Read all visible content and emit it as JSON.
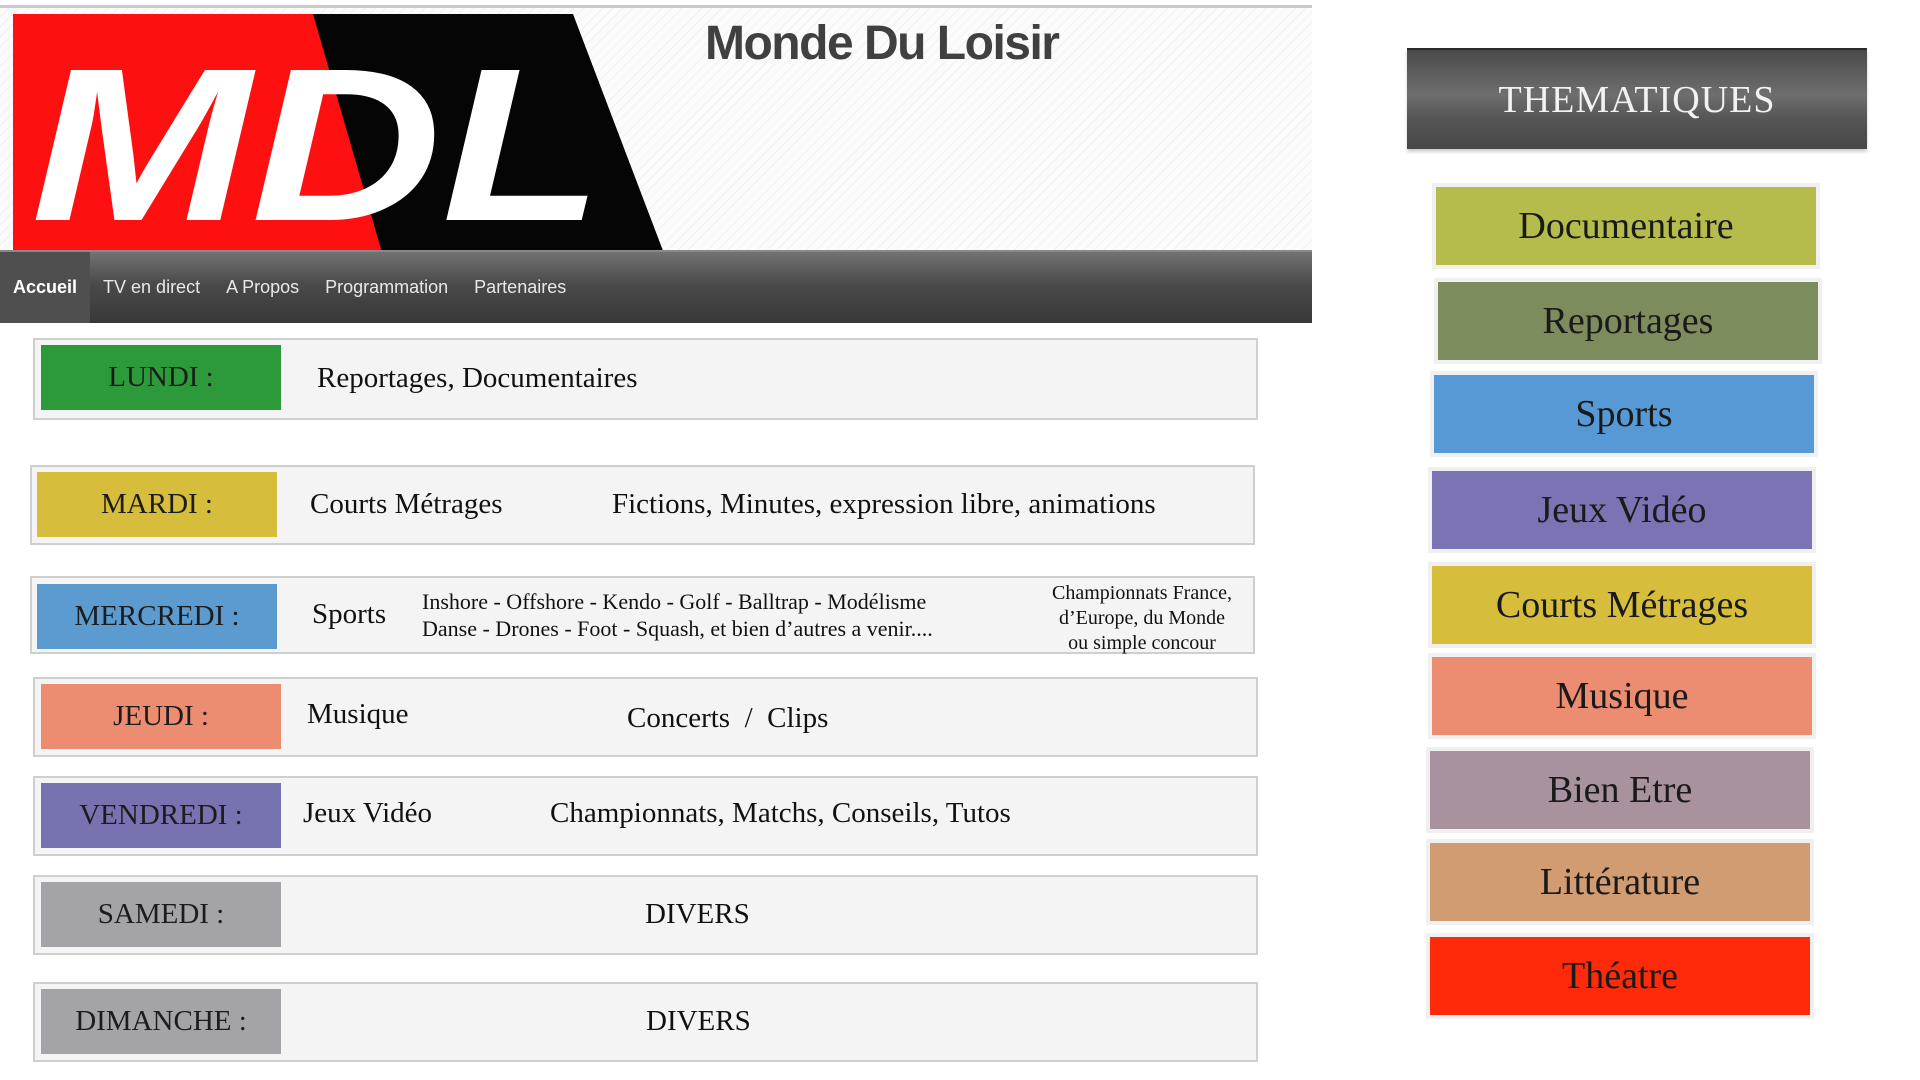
{
  "site": {
    "logo_text": "MDL",
    "title": "Monde Du Loisir"
  },
  "nav": {
    "items": [
      {
        "label": "Accueil",
        "active": true
      },
      {
        "label": "TV en direct"
      },
      {
        "label": "A Propos"
      },
      {
        "label": "Programmation"
      },
      {
        "label": "Partenaires"
      }
    ]
  },
  "schedule": [
    {
      "day": "LUNDI :",
      "color": "#2c9a3a",
      "main": "Reportages, Documentaires"
    },
    {
      "day": "MARDI :",
      "color": "#d6be3c",
      "main": "Courts Métrages",
      "detail": "Fictions, Minutes, expression libre, animations"
    },
    {
      "day": "MERCREDI :",
      "color": "#5b9bd0",
      "main": "Sports",
      "detail_line1": "Inshore - Offshore - Kendo - Golf - Balltrap - Modélisme",
      "detail_line2": "Danse - Drones - Foot - Squash, et bien d’autres a venir....",
      "extra_line1": "Championnats France,",
      "extra_line2": "d’Europe, du Monde",
      "extra_line3": "ou simple concour"
    },
    {
      "day": "JEUDI :",
      "color": "#ec8c70",
      "main": "Musique",
      "detail": "Concerts  /  Clips"
    },
    {
      "day": "VENDREDI :",
      "color": "#7772b0",
      "main": "Jeux Vidéo",
      "detail": "Championnats, Matchs, Conseils, Tutos"
    },
    {
      "day": "SAMEDI :",
      "color": "#a4a4a8",
      "detail": "DIVERS"
    },
    {
      "day": "DIMANCHE :",
      "color": "#a4a4a8",
      "detail": "DIVERS"
    }
  ],
  "themes": {
    "title": "THEMATIQUES",
    "items": [
      {
        "label": "Documentaire",
        "color": "#b6bc4c"
      },
      {
        "label": "Reportages",
        "color": "#7c8c5c"
      },
      {
        "label": "Sports",
        "color": "#5799d4"
      },
      {
        "label": "Jeux Vidéo",
        "color": "#7a74b4"
      },
      {
        "label": "Courts Métrages",
        "color": "#d6be3c"
      },
      {
        "label": "Musique",
        "color": "#ec8c70"
      },
      {
        "label": "Bien Etre",
        "color": "#a892a0"
      },
      {
        "label": "Littérature",
        "color": "#d29c72"
      },
      {
        "label": "Théatre",
        "color": "#ff2a0a"
      }
    ]
  }
}
